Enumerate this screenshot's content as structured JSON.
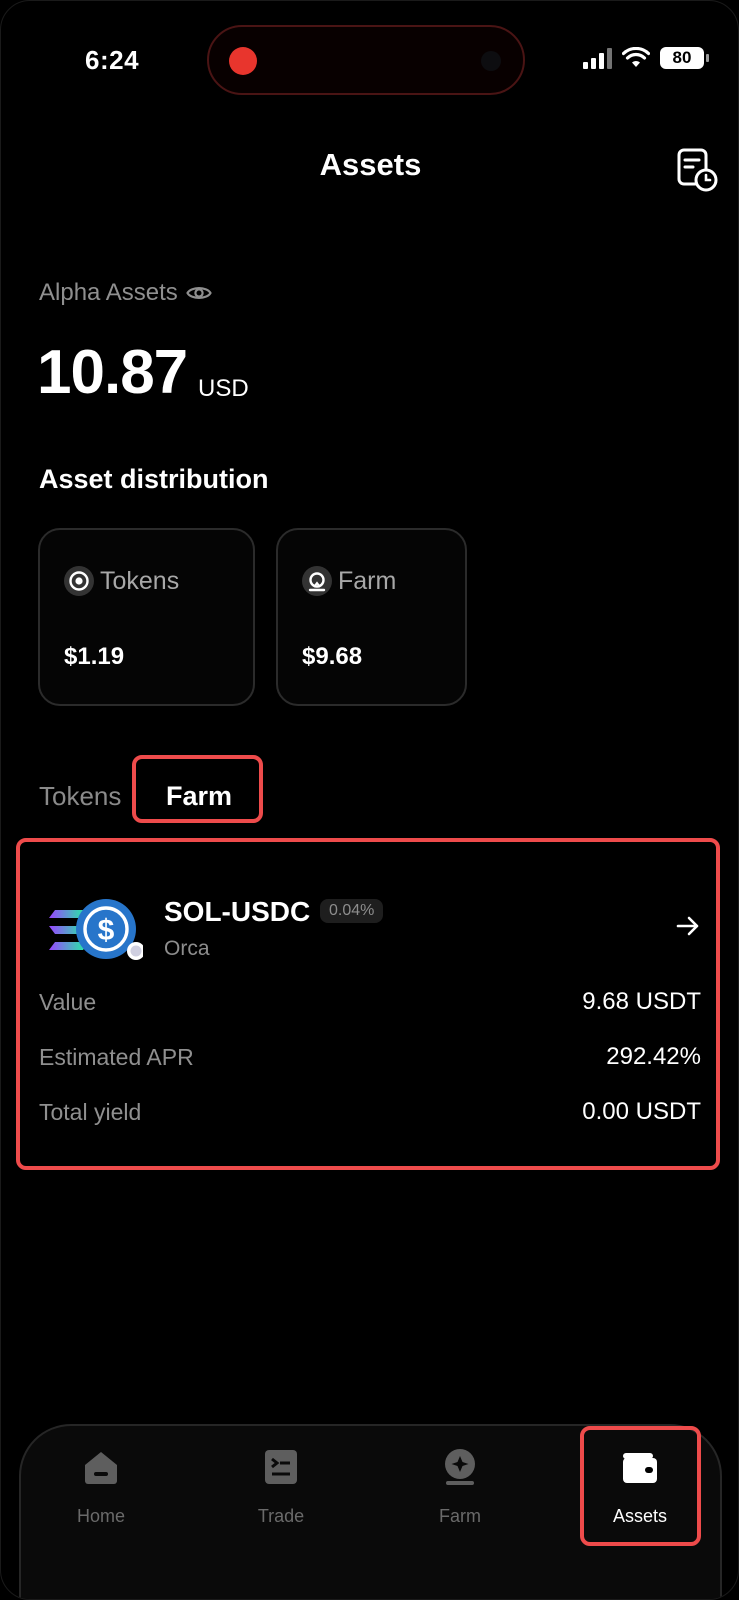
{
  "status_bar": {
    "time": "6:24",
    "battery": "80"
  },
  "header": {
    "title": "Assets",
    "history_icon": "history-document-icon"
  },
  "balance": {
    "label": "Alpha Assets",
    "amount": "10.87",
    "unit": "USD",
    "visibility_icon": "eye-icon"
  },
  "distribution": {
    "title": "Asset distribution",
    "cards": [
      {
        "label": "Tokens",
        "value": "$1.19",
        "icon": "target-icon"
      },
      {
        "label": "Farm",
        "value": "$9.68",
        "icon": "farm-icon"
      }
    ]
  },
  "tabs": {
    "items": [
      "Tokens",
      "Farm"
    ],
    "active": "Farm"
  },
  "position": {
    "pair": "SOL-USDC",
    "fee": "0.04%",
    "dex": "Orca",
    "rows": [
      {
        "label": "Value",
        "value": "9.68 USDT"
      },
      {
        "label": "Estimated APR",
        "value": "292.42%"
      },
      {
        "label": "Total yield",
        "value": "0.00 USDT"
      }
    ]
  },
  "bottom_nav": {
    "items": [
      {
        "label": "Home",
        "icon": "home-icon"
      },
      {
        "label": "Trade",
        "icon": "trade-icon"
      },
      {
        "label": "Farm",
        "icon": "farm-icon"
      },
      {
        "label": "Assets",
        "icon": "wallet-icon"
      }
    ],
    "active": "Assets"
  },
  "colors": {
    "background": "#000000",
    "highlight": "#ee4b4b",
    "muted_text": "#8f8f8f",
    "usdc_blue": "#2775ca"
  }
}
